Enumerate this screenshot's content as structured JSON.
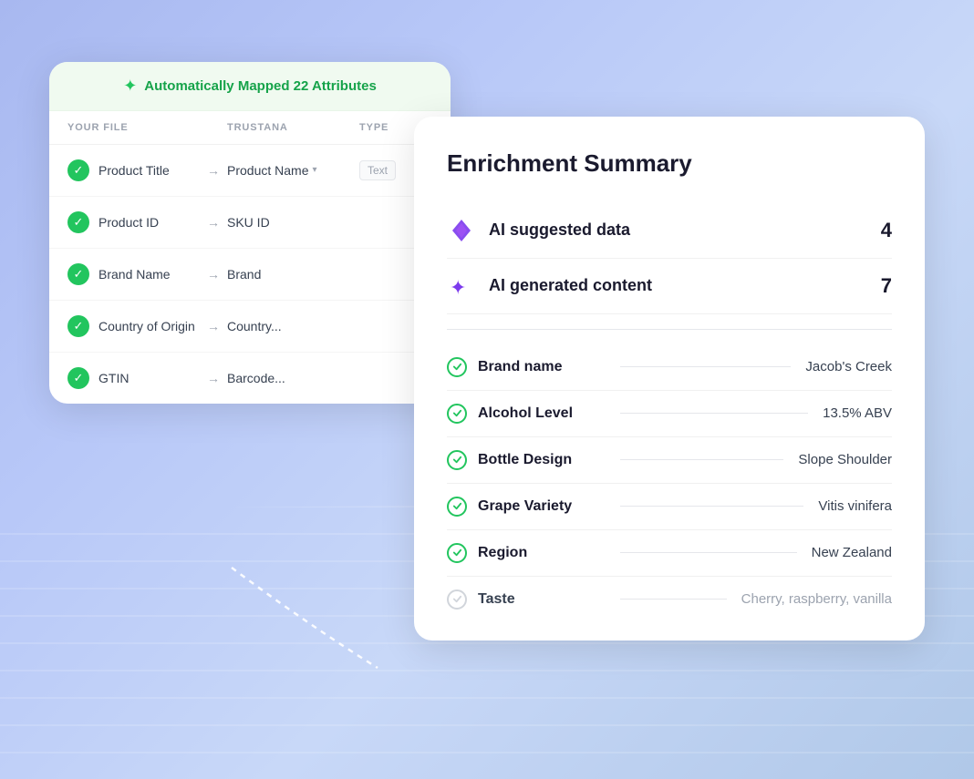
{
  "mapping_card": {
    "header": {
      "icon": "✦",
      "text": "Automatically Mapped 22 Attributes"
    },
    "table_headers": {
      "your_file": "YOUR FILE",
      "trustana": "TRUSTANA",
      "type": "TYPE"
    },
    "rows": [
      {
        "file_field": "Product Title",
        "trustana_field": "Product Name",
        "has_dropdown": true,
        "type": "Text"
      },
      {
        "file_field": "Product ID",
        "trustana_field": "SKU ID",
        "has_dropdown": false,
        "type": ""
      },
      {
        "file_field": "Brand Name",
        "trustana_field": "Brand",
        "has_dropdown": false,
        "type": ""
      },
      {
        "file_field": "Country of Origin",
        "trustana_field": "Country...",
        "has_dropdown": false,
        "type": ""
      },
      {
        "file_field": "GTIN",
        "trustana_field": "Barcode...",
        "has_dropdown": false,
        "type": ""
      }
    ]
  },
  "enrichment_card": {
    "title": "Enrichment Summary",
    "ai_rows": [
      {
        "icon": "diamond",
        "label": "AI suggested data",
        "count": "4"
      },
      {
        "icon": "sparkle",
        "label": "AI generated content",
        "count": "7"
      }
    ],
    "attributes": [
      {
        "name": "Brand name",
        "value": "Jacob's Creek",
        "faded": false
      },
      {
        "name": "Alcohol Level",
        "value": "13.5%  ABV",
        "faded": false
      },
      {
        "name": "Bottle Design",
        "value": "Slope Shoulder",
        "faded": false
      },
      {
        "name": "Grape Variety",
        "value": "Vitis vinifera",
        "faded": false
      },
      {
        "name": "Region",
        "value": "New Zealand",
        "faded": false
      },
      {
        "name": "Taste",
        "value": "Cherry, raspberry, vanilla",
        "faded": true
      }
    ]
  }
}
